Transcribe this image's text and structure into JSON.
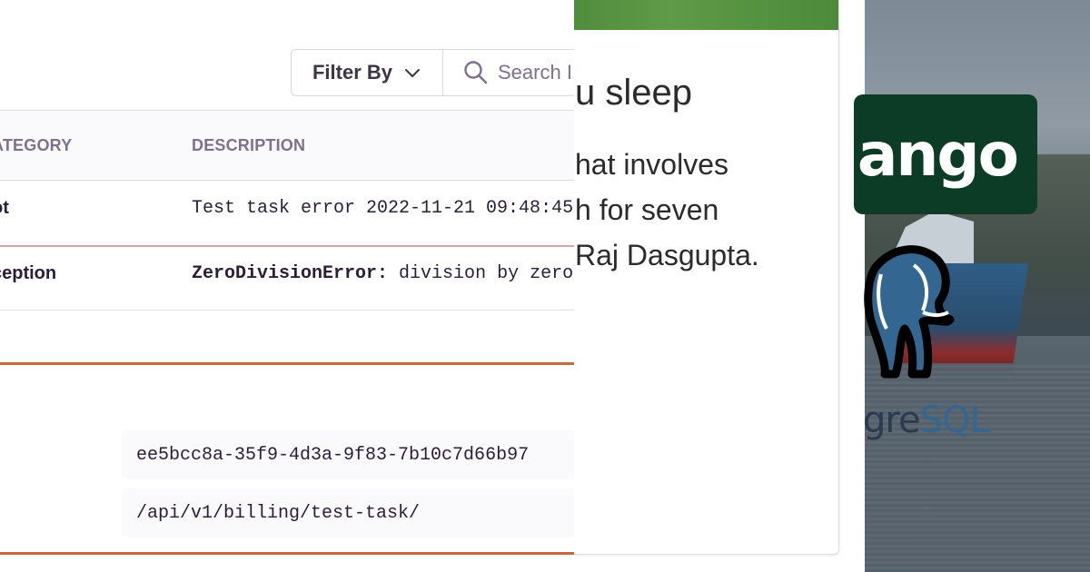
{
  "toolbar": {
    "filter_label": "Filter By",
    "search_placeholder": "Search I"
  },
  "table": {
    "headers": [
      "ATEGORY",
      "DESCRIPTION"
    ],
    "rows": [
      {
        "category": "ot",
        "message": "Test task error 2022-11-21 09:48:45",
        "exception_type": ""
      },
      {
        "category": "ception",
        "message": " division by zero",
        "exception_type": "ZeroDivisionError:"
      }
    ]
  },
  "details": {
    "event_id": "ee5bcc8a-35f9-4d3a-9f83-7b10c7d66b97",
    "url": "/api/v1/billing/test-task/"
  },
  "article": {
    "title": "u sleep",
    "lines": [
      "hat involves",
      "h for seven",
      " Raj Dasgupta."
    ]
  },
  "logos": {
    "django": "ango",
    "postgres_a": "gre",
    "postgres_b": "SQL"
  },
  "colors": {
    "accent_separator": "#c8673d",
    "error_row_border": "#e0a0a6",
    "django_green": "#0c3c26",
    "postgres_blue": "#336791"
  },
  "icons": [
    "chevron-down-icon",
    "search-icon",
    "postgres-elephant-icon"
  ]
}
